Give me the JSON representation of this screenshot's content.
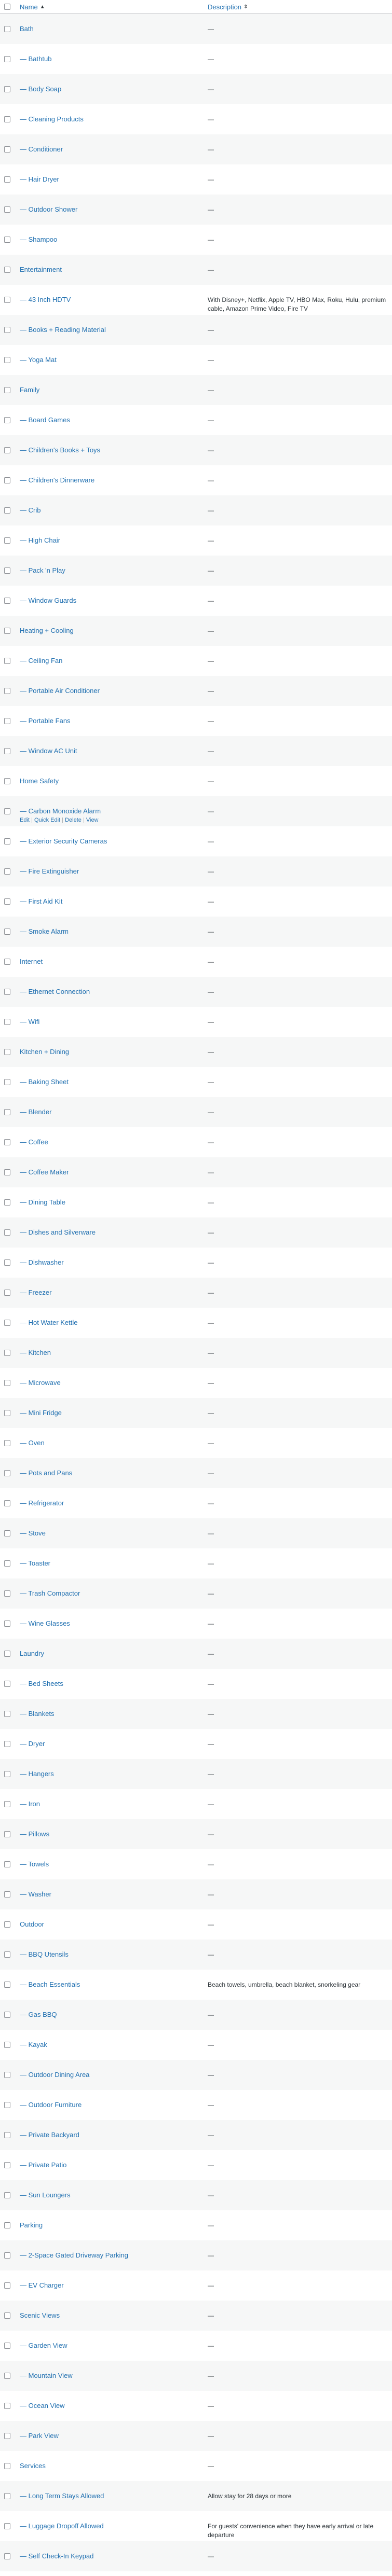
{
  "header": {
    "name_label": "Name",
    "name_sort": "▲",
    "description_label": "Description",
    "description_sort": "⇕"
  },
  "row_actions": {
    "edit": "Edit",
    "quick_edit": "Quick Edit",
    "delete": "Delete",
    "view": "View",
    "separator": "|"
  },
  "rows": [
    {
      "name": "Bath",
      "description": "—"
    },
    {
      "name": "— Bathtub",
      "description": "—"
    },
    {
      "name": "— Body Soap",
      "description": "—"
    },
    {
      "name": "— Cleaning Products",
      "description": "—"
    },
    {
      "name": "— Conditioner",
      "description": "—"
    },
    {
      "name": "— Hair Dryer",
      "description": "—"
    },
    {
      "name": "— Outdoor Shower",
      "description": "—"
    },
    {
      "name": "— Shampoo",
      "description": "—"
    },
    {
      "name": "Entertainment",
      "description": "—"
    },
    {
      "name": "— 43 Inch HDTV",
      "description": "With Disney+, Netflix, Apple TV, HBO Max, Roku, Hulu, premium cable, Amazon Prime Video, Fire TV"
    },
    {
      "name": "— Books + Reading Material",
      "description": "—"
    },
    {
      "name": "— Yoga Mat",
      "description": "—"
    },
    {
      "name": "Family",
      "description": "—"
    },
    {
      "name": "— Board Games",
      "description": "—"
    },
    {
      "name": "— Children's Books + Toys",
      "description": "—"
    },
    {
      "name": "— Children's Dinnerware",
      "description": "—"
    },
    {
      "name": "— Crib",
      "description": "—"
    },
    {
      "name": "— High Chair",
      "description": "—"
    },
    {
      "name": "— Pack 'n Play",
      "description": "—"
    },
    {
      "name": "— Window Guards",
      "description": "—"
    },
    {
      "name": "Heating + Cooling",
      "description": "—"
    },
    {
      "name": "— Ceiling Fan",
      "description": "—"
    },
    {
      "name": "— Portable Air Conditioner",
      "description": "—"
    },
    {
      "name": "— Portable Fans",
      "description": "—"
    },
    {
      "name": "— Window AC Unit",
      "description": "—"
    },
    {
      "name": "Home Safety",
      "description": "—"
    },
    {
      "name": "— Carbon Monoxide Alarm",
      "description": "—",
      "show_actions": true
    },
    {
      "name": "— Exterior Security Cameras",
      "description": "—"
    },
    {
      "name": "— Fire Extinguisher",
      "description": "—"
    },
    {
      "name": "— First Aid Kit",
      "description": "—"
    },
    {
      "name": "— Smoke Alarm",
      "description": "—"
    },
    {
      "name": "Internet",
      "description": "—"
    },
    {
      "name": "— Ethernet Connection",
      "description": "—"
    },
    {
      "name": "— Wifi",
      "description": "—"
    },
    {
      "name": "Kitchen + Dining",
      "description": "—"
    },
    {
      "name": "— Baking Sheet",
      "description": "—"
    },
    {
      "name": "— Blender",
      "description": "—"
    },
    {
      "name": "— Coffee",
      "description": "—"
    },
    {
      "name": "— Coffee Maker",
      "description": "—"
    },
    {
      "name": "— Dining Table",
      "description": "—"
    },
    {
      "name": "— Dishes and Silverware",
      "description": "—"
    },
    {
      "name": "— Dishwasher",
      "description": "—"
    },
    {
      "name": "— Freezer",
      "description": "—"
    },
    {
      "name": "— Hot Water Kettle",
      "description": "—"
    },
    {
      "name": "— Kitchen",
      "description": "—"
    },
    {
      "name": "— Microwave",
      "description": "—"
    },
    {
      "name": "— Mini Fridge",
      "description": "—"
    },
    {
      "name": "— Oven",
      "description": "—"
    },
    {
      "name": "— Pots and Pans",
      "description": "—"
    },
    {
      "name": "— Refrigerator",
      "description": "—"
    },
    {
      "name": "— Stove",
      "description": "—"
    },
    {
      "name": "— Toaster",
      "description": "—"
    },
    {
      "name": "— Trash Compactor",
      "description": "—"
    },
    {
      "name": "— Wine Glasses",
      "description": "—"
    },
    {
      "name": "Laundry",
      "description": "—"
    },
    {
      "name": "— Bed Sheets",
      "description": "—"
    },
    {
      "name": "— Blankets",
      "description": "—"
    },
    {
      "name": "— Dryer",
      "description": "—"
    },
    {
      "name": "— Hangers",
      "description": "—"
    },
    {
      "name": "— Iron",
      "description": "—"
    },
    {
      "name": "— Pillows",
      "description": "—"
    },
    {
      "name": "— Towels",
      "description": "—"
    },
    {
      "name": "— Washer",
      "description": "—"
    },
    {
      "name": "Outdoor",
      "description": "—"
    },
    {
      "name": "— BBQ Utensils",
      "description": "—"
    },
    {
      "name": "— Beach Essentials",
      "description": "Beach towels, umbrella, beach blanket, snorkeling gear"
    },
    {
      "name": "— Gas BBQ",
      "description": "—"
    },
    {
      "name": "— Kayak",
      "description": "—"
    },
    {
      "name": "— Outdoor Dining Area",
      "description": "—"
    },
    {
      "name": "— Outdoor Furniture",
      "description": "—"
    },
    {
      "name": "— Private Backyard",
      "description": "—"
    },
    {
      "name": "— Private Patio",
      "description": "—"
    },
    {
      "name": "— Sun Loungers",
      "description": "—"
    },
    {
      "name": "Parking",
      "description": "—"
    },
    {
      "name": "— 2-Space Gated Driveway Parking",
      "description": "—"
    },
    {
      "name": "— EV Charger",
      "description": "—"
    },
    {
      "name": "Scenic Views",
      "description": "—"
    },
    {
      "name": "— Garden View",
      "description": "—"
    },
    {
      "name": "— Mountain View",
      "description": "—"
    },
    {
      "name": "— Ocean View",
      "description": "—"
    },
    {
      "name": "— Park View",
      "description": "—"
    },
    {
      "name": "Services",
      "description": "—"
    },
    {
      "name": "— Long Term Stays Allowed",
      "description": "Allow stay for 28 days or more"
    },
    {
      "name": "— Luggage Dropoff Allowed",
      "description": "For guests' convenience when they have early arrival or late departure"
    },
    {
      "name": "— Self Check-In Keypad",
      "description": "—"
    }
  ]
}
